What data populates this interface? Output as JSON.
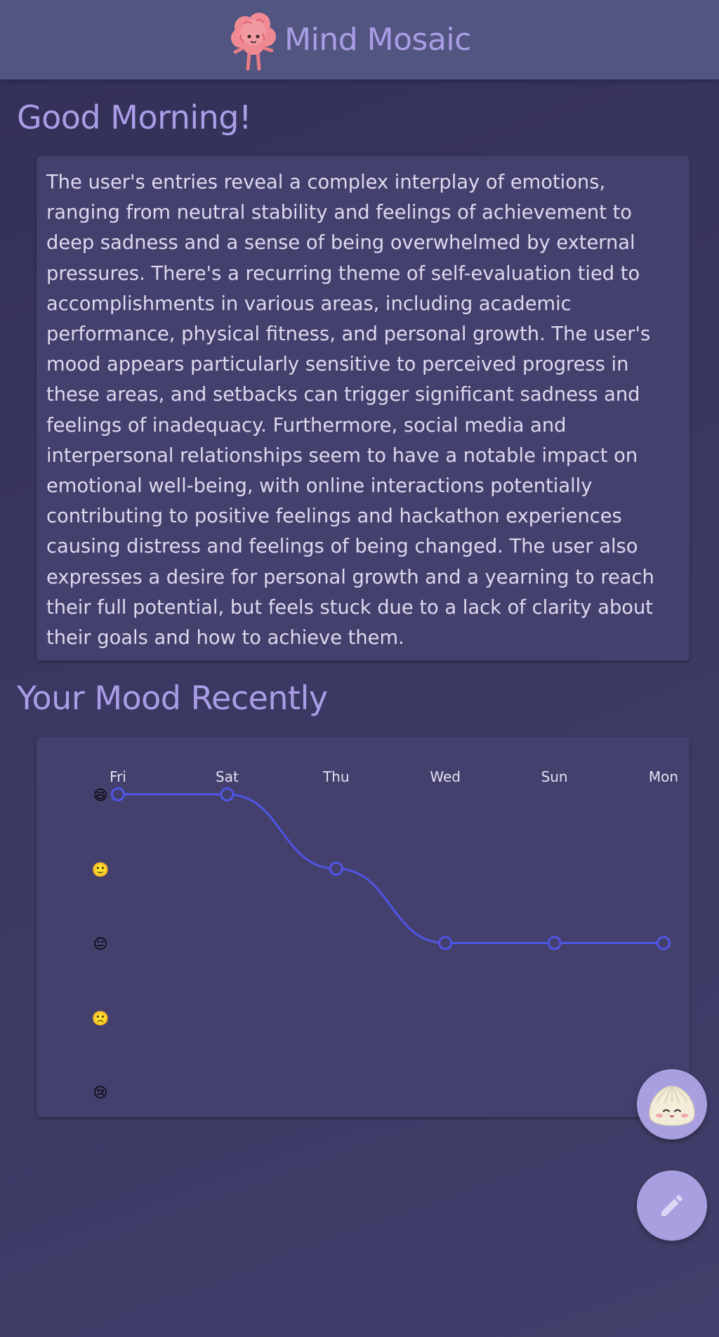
{
  "header": {
    "app_title": "Mind Mosaic",
    "logo_icon": "brain-mascot-icon"
  },
  "greeting": "Good Morning!",
  "summary": {
    "text": "The user's entries reveal a complex interplay of emotions, ranging from neutral stability and feelings of achievement to deep sadness and a sense of being overwhelmed by external pressures. There's a recurring theme of self-evaluation tied to accomplishments in various areas, including academic performance, physical fitness, and personal growth. The user's mood appears particularly sensitive to perceived progress in these areas, and setbacks can trigger significant sadness and feelings of inadequacy. Furthermore, social media and interpersonal relationships seem to have a notable impact on emotional well-being, with online interactions potentially contributing to positive feelings and hackathon experiences causing distress and feelings of being changed. The user also expresses a desire for personal growth and a yearning to reach their full potential, but feels stuck due to a lack of clarity about their goals and how to achieve them."
  },
  "mood_section": {
    "title": "Your Mood Recently"
  },
  "chart_data": {
    "type": "line",
    "categories": [
      "Fri",
      "Sat",
      "Thu",
      "Wed",
      "Sun",
      "Mon"
    ],
    "values": [
      5,
      5,
      4,
      3,
      3,
      3
    ],
    "y_levels": [
      5,
      4,
      3,
      2,
      1
    ],
    "y_tick_labels": [
      "😄",
      "🙂",
      "😐",
      "🙁",
      "😢"
    ],
    "ylim": [
      1,
      5
    ],
    "x_axis_position": "top",
    "grid": false,
    "legend": "none",
    "line_color": "#4f55e6",
    "point_fill": "#44406d"
  },
  "fabs": {
    "assistant_icon": "dumpling-mascot-icon",
    "edit_icon": "pencil-icon"
  },
  "colors": {
    "accent": "#a99ee6",
    "header_bg": "#525580",
    "card_bg": "#44406d",
    "fab_bg": "#a79fe0"
  }
}
